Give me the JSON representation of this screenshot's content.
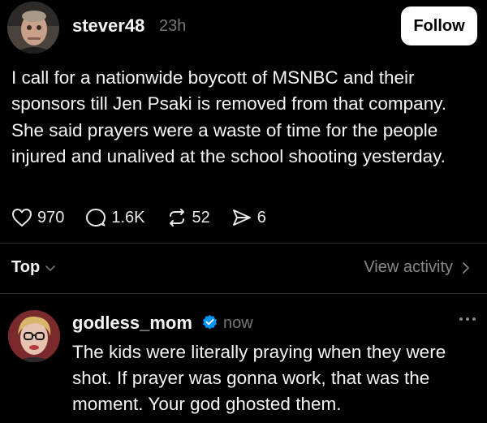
{
  "post": {
    "author": "stever48",
    "time": "23h",
    "follow_label": "Follow",
    "text": "I call for a nationwide boycott of MSNBC and their sponsors till Jen Psaki is removed from that company. She said prayers were a waste of time for the people injured and unalived at the school shooting yesterday.",
    "likes": "970",
    "replies": "1.6K",
    "reposts": "52",
    "shares": "6"
  },
  "thread_controls": {
    "sort_label": "Top",
    "view_activity_label": "View activity"
  },
  "reply": {
    "author": "godless_mom",
    "verified": true,
    "time": "now",
    "text": "The kids were literally praying when they were shot. If prayer was gonna work, that was the moment. Your god ghosted them."
  },
  "colors": {
    "background": "#000000",
    "text": "#f3f5f7",
    "muted": "#777777",
    "verified": "#0095f6"
  }
}
